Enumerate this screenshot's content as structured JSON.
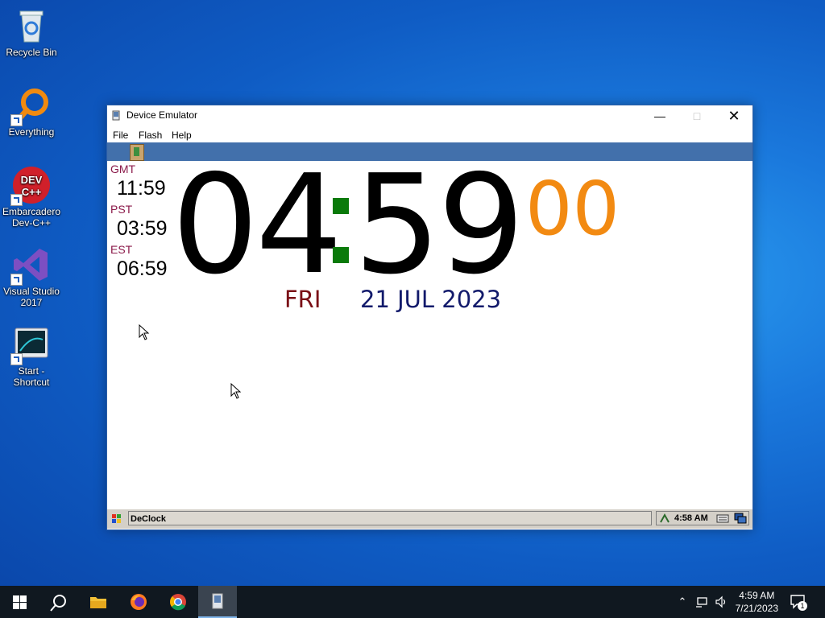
{
  "desktop": {
    "icons": [
      {
        "label": "Recycle Bin"
      },
      {
        "label": "Everything"
      },
      {
        "label": "Embarcadero Dev-C++"
      },
      {
        "label": "Visual Studio 2017"
      },
      {
        "label": "Start - Shortcut"
      }
    ]
  },
  "window": {
    "title": "Device Emulator",
    "menu": [
      "File",
      "Flash",
      "Help"
    ]
  },
  "clock": {
    "zones": [
      {
        "label": "GMT",
        "time": "11:59"
      },
      {
        "label": "PST",
        "time": "03:59"
      },
      {
        "label": "EST",
        "time": "06:59"
      }
    ],
    "hours": "04",
    "minutes": "59",
    "seconds": "00",
    "day": "FRI",
    "date": "21 JUL 2023",
    "colors": {
      "colon": "#0a7a0a",
      "seconds": "#f28a12",
      "day": "#7a0f16",
      "date": "#121a6b"
    }
  },
  "device_taskbar": {
    "task": "DeClock",
    "time": "4:58 AM"
  },
  "taskbar": {
    "time": "4:59 AM",
    "date": "7/21/2023",
    "notification_count": "1"
  }
}
